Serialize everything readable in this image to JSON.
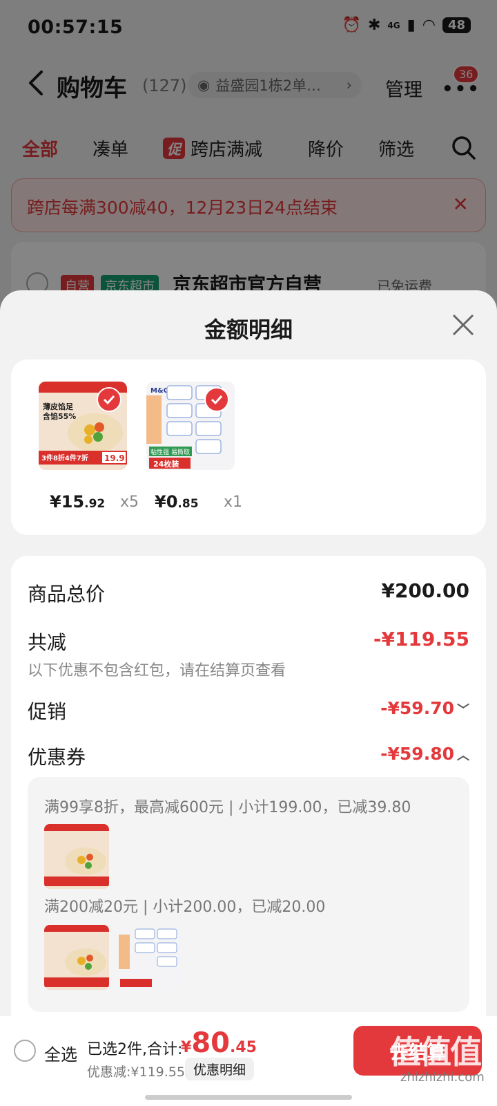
{
  "status": {
    "time": "00:57:15",
    "network": "4G",
    "battery": "48"
  },
  "nav": {
    "title": "购物车",
    "count": "(127)",
    "address": "益盛园1栋2单…",
    "manage": "管理",
    "message_badge": "36"
  },
  "tabs": [
    {
      "label": "全部",
      "active": true
    },
    {
      "label": "凑单",
      "active": false
    },
    {
      "label": "跨店满减",
      "tag": "促",
      "active": false
    },
    {
      "label": "降价",
      "active": false
    },
    {
      "label": "筛选",
      "active": false
    }
  ],
  "promo_banner": "跨店每满300减40，12月23日24点结束",
  "shop": {
    "tag_self": "自营",
    "tag_market": "京东超市",
    "name": "京东超市官方自营",
    "shipping": "已免运费"
  },
  "sheet": {
    "title": "金额明细",
    "items": [
      {
        "price_int": "¥15",
        "price_dec": ".92",
        "qty": "x5",
        "thumb_lines": [
          "薄皮馅足",
          "含馅55%"
        ],
        "thumb_promo": "3件8折4件7折",
        "thumb_price": "19.9"
      },
      {
        "price_int": "¥0",
        "price_dec": ".85",
        "qty": "x1",
        "thumb_top": "M&G",
        "thumb_lines": [
          "粘性强",
          "易撕取"
        ],
        "thumb_promo": "24枚装"
      }
    ],
    "total_price": {
      "label": "商品总价",
      "value": "¥200.00"
    },
    "total_discount": {
      "label": "共减",
      "value": "-¥119.55",
      "note": "以下优惠不包含红包，请在结算页查看"
    },
    "promotion": {
      "label": "促销",
      "value": "-¥59.70"
    },
    "coupon": {
      "label": "优惠券",
      "value": "-¥59.80"
    },
    "coupon_details": [
      "满99享8折，最高减600元 | 小计199.00，已减39.80",
      "满200减20元 | 小计200.00，已减20.00"
    ]
  },
  "bottom": {
    "select_all": "全选",
    "selected_text": "已选2件,合计:",
    "total_currency": "¥",
    "total_int": "80",
    "total_dec": ".45",
    "discount_text": "优惠减:¥119.55",
    "detail_button": "优惠明细",
    "checkout": "去结算",
    "watermark": "值值值",
    "watermark_sub": "zhizhizhi.com"
  },
  "colors": {
    "accent": "#e4393c",
    "green": "#16a070"
  }
}
